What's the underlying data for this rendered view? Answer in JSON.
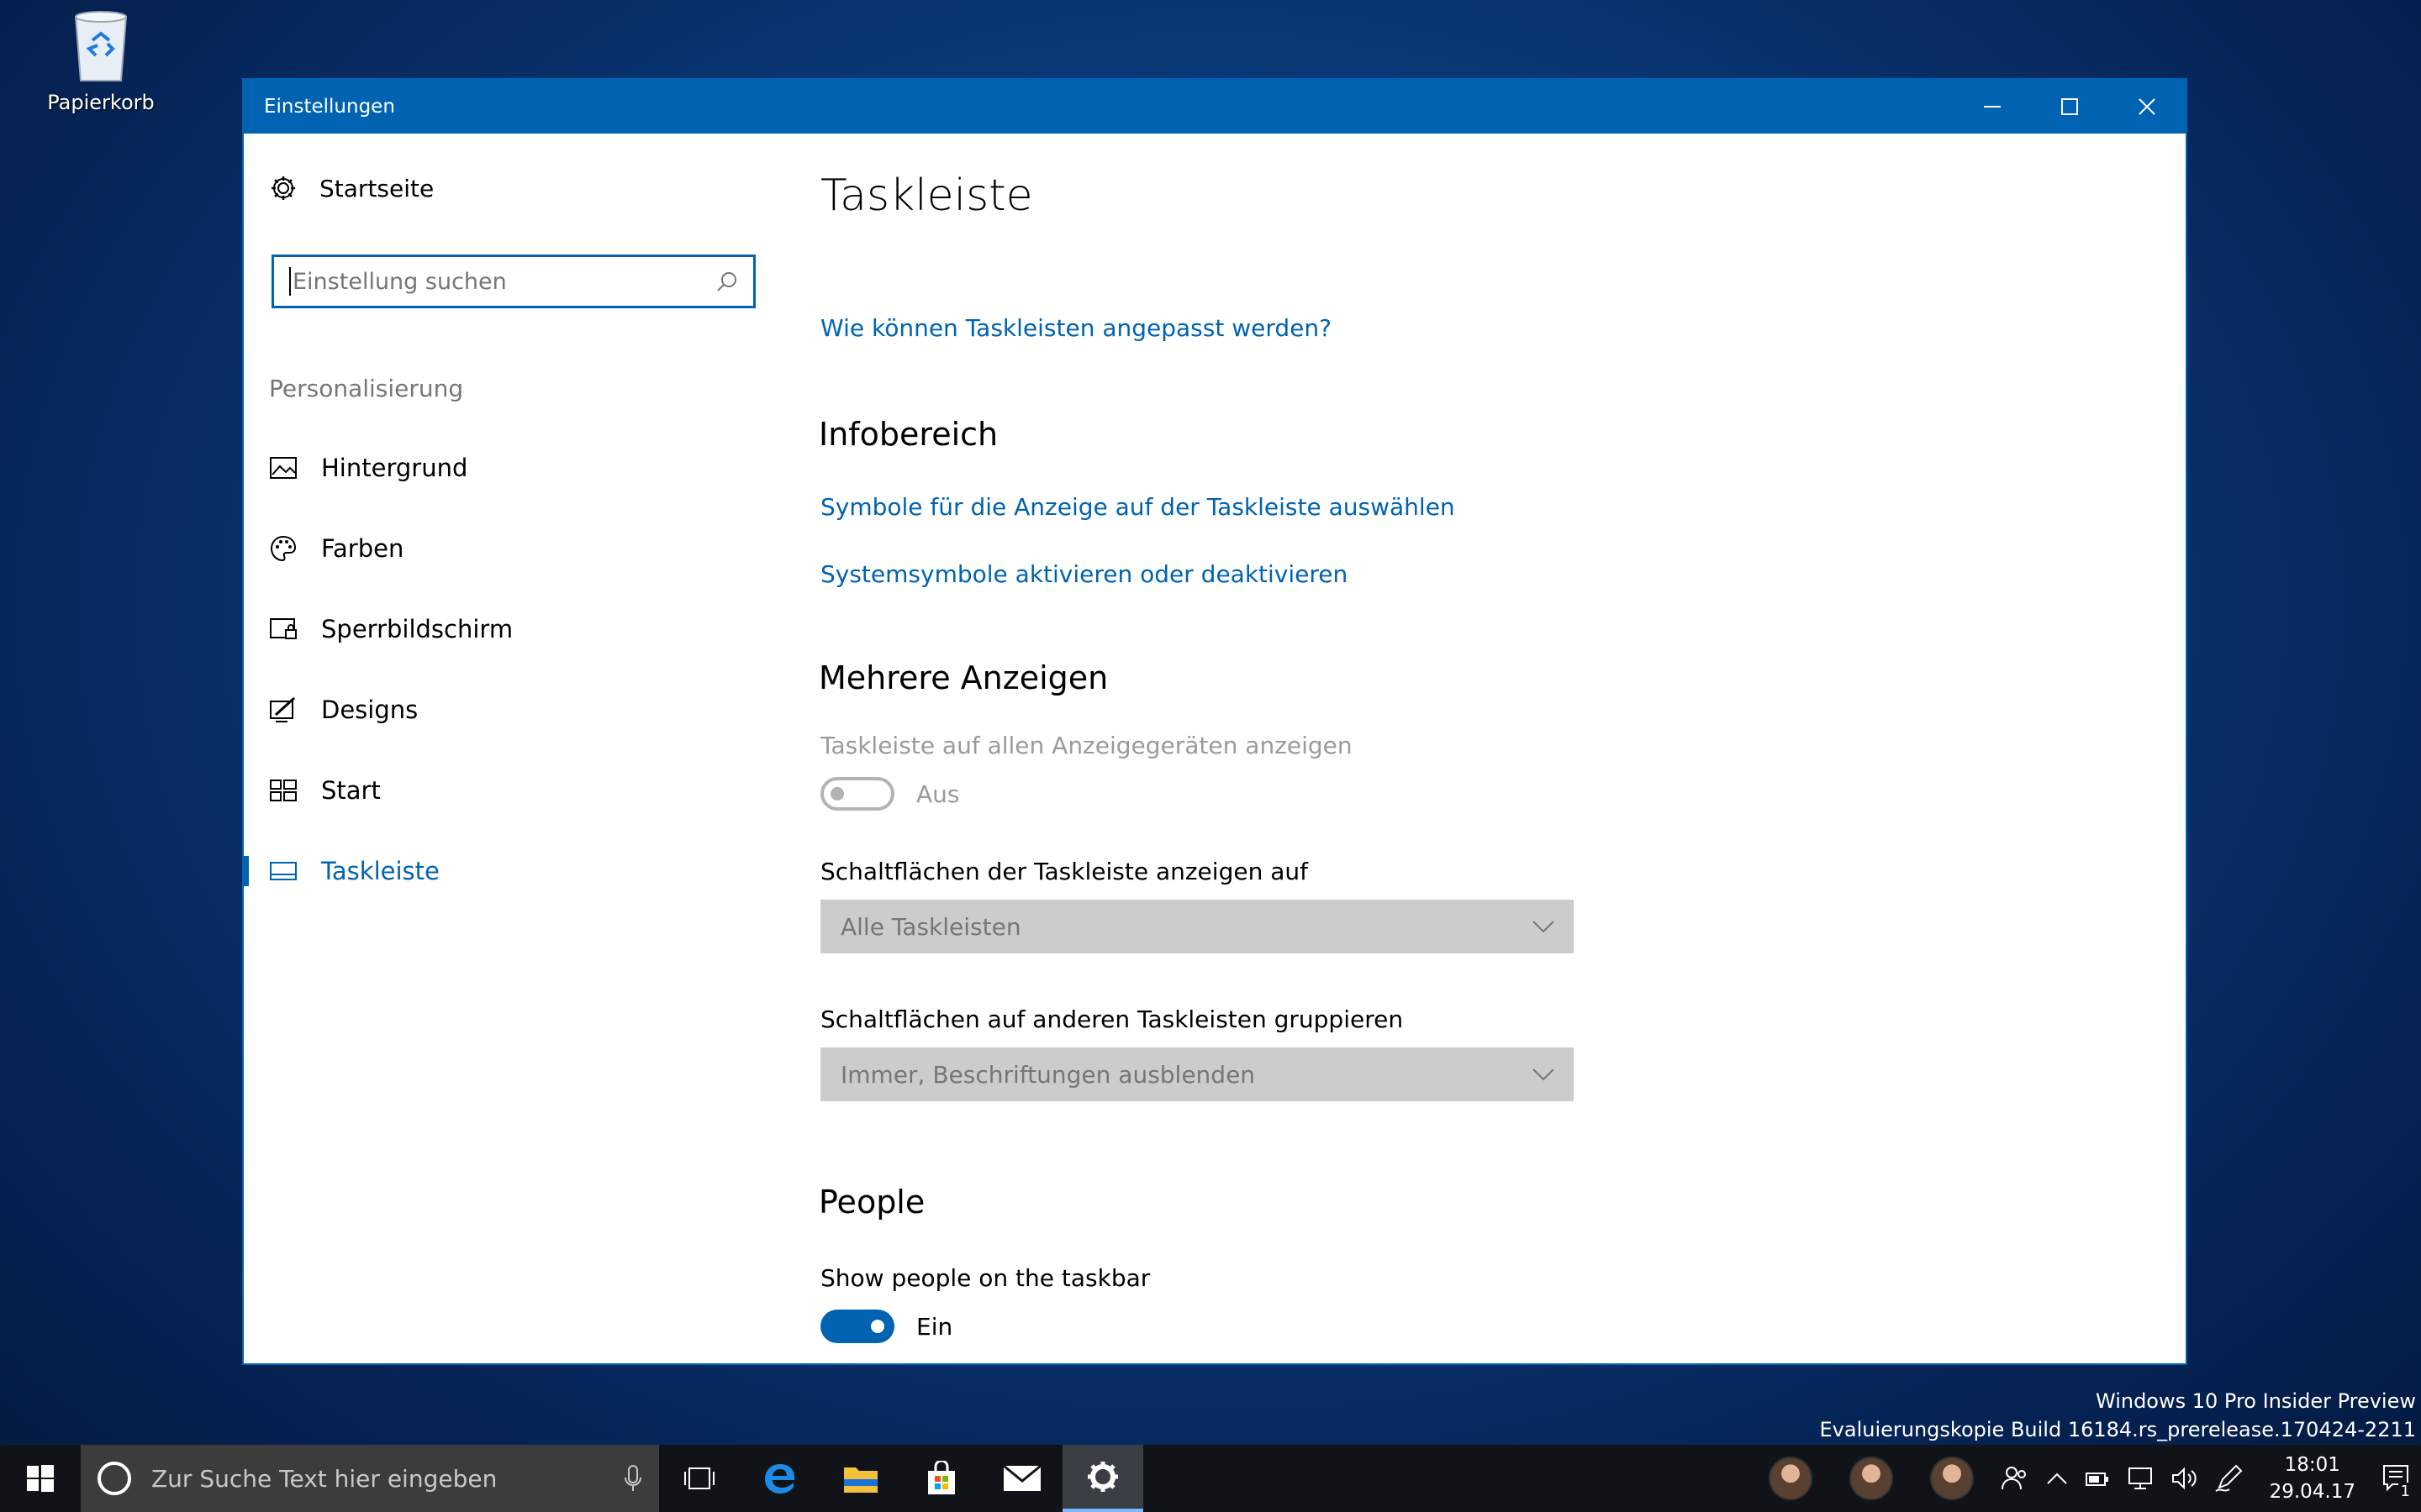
{
  "desktop": {
    "recycle_bin_label": "Papierkorb"
  },
  "window": {
    "title": "Einstellungen",
    "controls": {
      "minimize": "minimize",
      "maximize": "maximize",
      "close": "close"
    }
  },
  "sidebar": {
    "home_label": "Startseite",
    "search_placeholder": "Einstellung suchen",
    "section_label": "Personalisierung",
    "items": [
      {
        "label": "Hintergrund",
        "icon": "picture-icon"
      },
      {
        "label": "Farben",
        "icon": "palette-icon"
      },
      {
        "label": "Sperrbildschirm",
        "icon": "lockscreen-icon"
      },
      {
        "label": "Designs",
        "icon": "themes-icon"
      },
      {
        "label": "Start",
        "icon": "start-tiles-icon"
      },
      {
        "label": "Taskleiste",
        "icon": "taskbar-icon",
        "active": true
      }
    ]
  },
  "content": {
    "title": "Taskleiste",
    "help_link": "Wie können Taskleisten angepasst werden?",
    "infobereich": {
      "heading": "Infobereich",
      "link1": "Symbole für die Anzeige auf der Taskleiste auswählen",
      "link2": "Systemsymbole aktivieren oder deaktivieren"
    },
    "mehrere": {
      "heading": "Mehrere Anzeigen",
      "toggle_label": "Taskleiste auf allen Anzeigegeräten anzeigen",
      "toggle_state": "Aus",
      "select1_label": "Schaltflächen der Taskleiste anzeigen auf",
      "select1_value": "Alle Taskleisten",
      "select2_label": "Schaltflächen auf anderen Taskleisten gruppieren",
      "select2_value": "Immer, Beschriftungen ausblenden"
    },
    "people": {
      "heading": "People",
      "toggle_label": "Show people on the taskbar",
      "toggle_state": "Ein"
    }
  },
  "watermark": {
    "line1": "Windows 10 Pro Insider Preview",
    "line2": "Evaluierungskopie Build 16184.rs_prerelease.170424-2211"
  },
  "taskbar": {
    "search_placeholder": "Zur Suche Text hier eingeben",
    "time": "18:01",
    "date": "29.04.17",
    "notification_count": "1"
  },
  "colors": {
    "accent": "#0063b1",
    "disabled": "#cccccc"
  }
}
